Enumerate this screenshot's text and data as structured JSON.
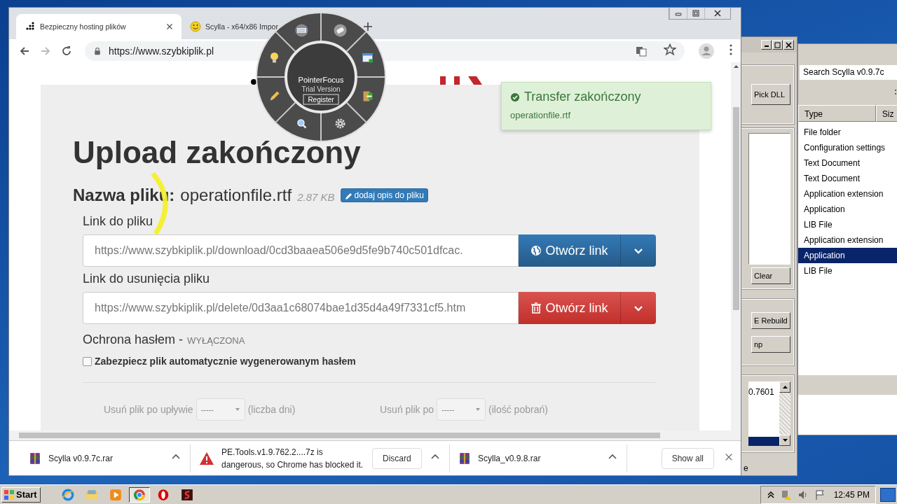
{
  "browser": {
    "tabs": [
      {
        "title": "Bezpieczny hosting plików",
        "selected": true
      },
      {
        "title": "Scylla - x64/x86 Impor",
        "selected": false
      }
    ],
    "address": "https://www.szybkiplik.pl"
  },
  "page": {
    "heading": "Upload zakończony",
    "file_label": "Nazwa pliku:",
    "file_name": "operationfile.rtf",
    "file_size": "2.87 KB",
    "describe_button": "dodaj opis do pliku",
    "links": [
      {
        "kind": "open",
        "label": "Link do pliku",
        "value": "https://www.szybkiplik.pl/download/0cd3baaea506e9d5fe9b740c501dfcac.",
        "button": "Otwórz link"
      },
      {
        "kind": "delete",
        "label": "Link do usunięcia pliku",
        "value": "https://www.szybkiplik.pl/delete/0d3aa1c68074bae1d35d4a49f7331cf5.htm",
        "button": "Otwórz link"
      }
    ],
    "password": {
      "label": "Ochrona hasłem -",
      "status": "WYŁĄCZONA",
      "checkbox_label": "Zabezpiecz plik automatycznie wygenerowanym hasłem",
      "checked": false
    },
    "expiry": [
      {
        "label": "Usuń plik po upływie",
        "value": "-----",
        "unit": "(liczba dni)"
      },
      {
        "label": "Usuń plik po",
        "value": "-----",
        "unit": "(ilość pobrań)"
      }
    ]
  },
  "toast": {
    "title": "Transfer zakończony",
    "file": "operationfile.rtf"
  },
  "pointer_focus": {
    "name": "PointerFocus",
    "edition": "Trial Version",
    "register": "Register"
  },
  "downloads": {
    "items": [
      {
        "kind": "archive",
        "name": "Scylla v0.9.7c.rar"
      },
      {
        "kind": "blocked",
        "name": "PE.Tools.v1.9.762.2....7z is dangerous, so Chrome has blocked it.",
        "action": "Discard"
      },
      {
        "kind": "archive",
        "name": "Scylla_v0.9.8.rar"
      }
    ],
    "show_all": "Show all"
  },
  "scylla": {
    "pick_button": "Pick DLL",
    "clear_button": "Clear",
    "rebuild_button": "E Rebuild",
    "dump_button": "np",
    "log_text": "0.7601",
    "status": "e"
  },
  "explorer": {
    "search": "Search Scylla v0.9.7c",
    "columns": [
      "Type",
      "Siz"
    ],
    "rows": [
      {
        "type": "File folder",
        "selected": false
      },
      {
        "type": "Configuration settings",
        "selected": false
      },
      {
        "type": "Text Document",
        "selected": false
      },
      {
        "type": "Text Document",
        "selected": false
      },
      {
        "type": "Application extension",
        "selected": false
      },
      {
        "type": "Application",
        "selected": false
      },
      {
        "type": "LIB File",
        "selected": false
      },
      {
        "type": "Application extension",
        "selected": false
      },
      {
        "type": "Application",
        "selected": true
      },
      {
        "type": "LIB File",
        "selected": false
      }
    ]
  },
  "taskbar": {
    "start": "Start",
    "apps": [
      {
        "kind": "ie",
        "selected": false
      },
      {
        "kind": "folder",
        "selected": false
      },
      {
        "kind": "media",
        "selected": false
      },
      {
        "kind": "chrome",
        "selected": true
      },
      {
        "kind": "opera",
        "selected": false
      },
      {
        "kind": "app",
        "selected": false
      }
    ],
    "clock": "12:45 PM"
  }
}
